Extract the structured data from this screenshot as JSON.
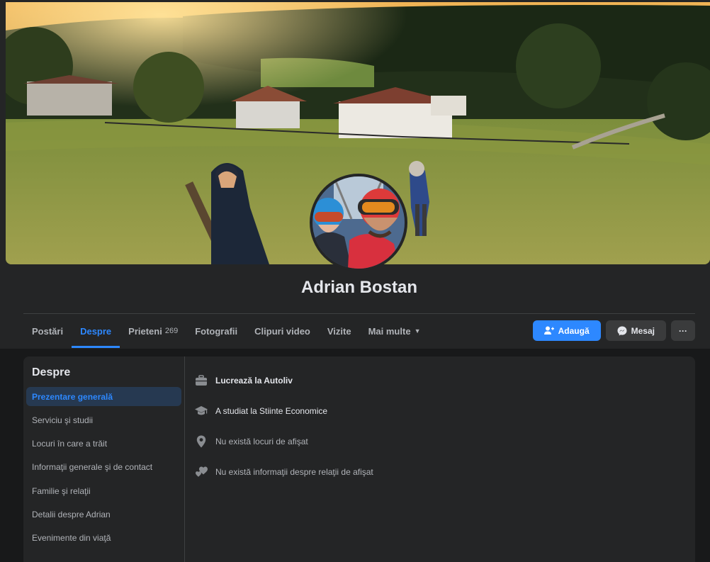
{
  "profile": {
    "name": "Adrian Bostan"
  },
  "tabs": [
    {
      "label": "Postări",
      "active": false
    },
    {
      "label": "Despre",
      "active": true
    },
    {
      "label": "Prieteni",
      "count": "269",
      "active": false
    },
    {
      "label": "Fotografii",
      "active": false
    },
    {
      "label": "Clipuri video",
      "active": false
    },
    {
      "label": "Vizite",
      "active": false
    },
    {
      "label": "Mai multe",
      "active": false
    }
  ],
  "actions": {
    "add_label": "Adaugă",
    "message_label": "Mesaj",
    "more_label": "···"
  },
  "about": {
    "title": "Despre",
    "nav": [
      "Prezentare generală",
      "Serviciu şi studii",
      "Locuri în care a trăit",
      "Informaţii generale şi de contact",
      "Familie şi relaţii",
      "Detalii despre Adrian",
      "Evenimente din viaţă"
    ],
    "overview": [
      {
        "icon": "briefcase-icon",
        "text": "Lucrează la Autoliv"
      },
      {
        "icon": "graduation-cap-icon",
        "text": "A studiat la Stiinte Economice"
      },
      {
        "icon": "location-pin-icon",
        "text": "Nu există locuri de afişat"
      },
      {
        "icon": "hearts-icon",
        "text": "Nu există informaţii despre relaţii de afişat"
      }
    ]
  },
  "colors": {
    "accent": "#2d88ff",
    "surface": "#242526",
    "background": "#18191a",
    "active_nav_bg": "#263951"
  }
}
